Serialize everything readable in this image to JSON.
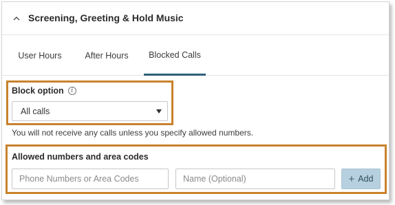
{
  "section": {
    "title": "Screening, Greeting & Hold Music",
    "toggle_icon": "chevron-up-icon"
  },
  "tabs": [
    {
      "label": "User Hours",
      "active": false
    },
    {
      "label": "After Hours",
      "active": false
    },
    {
      "label": "Blocked Calls",
      "active": true
    }
  ],
  "block_option": {
    "label": "Block option",
    "info_icon_glyph": "i",
    "selected_value": "All calls",
    "note": "You will not receive any calls unless you specify allowed numbers."
  },
  "allowed": {
    "label": "Allowed numbers and area codes",
    "phone_placeholder": "Phone Numbers or Area Codes",
    "name_placeholder": "Name (Optional)",
    "add_label": "Add",
    "add_icon": "+"
  },
  "colors": {
    "highlight_border": "#c8822c",
    "active_tab_underline": "#2f5f78",
    "add_button_bg": "#b7d0df"
  }
}
